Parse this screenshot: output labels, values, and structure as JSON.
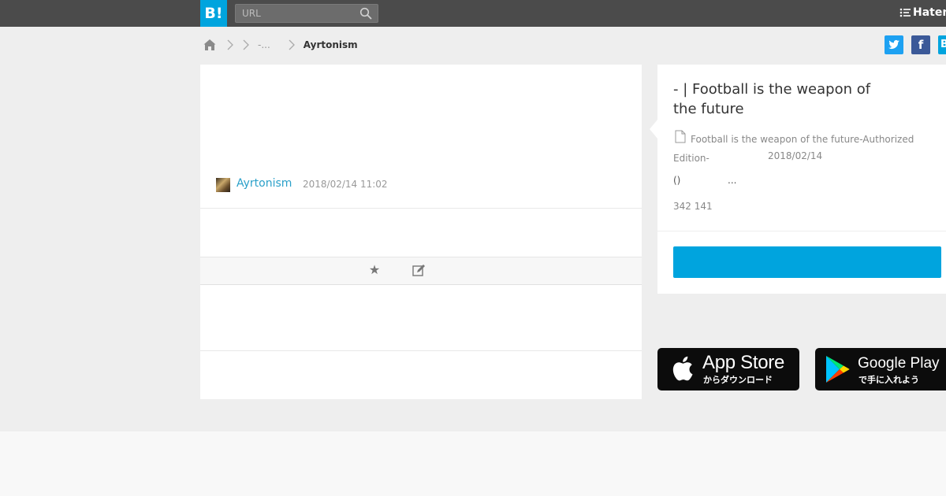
{
  "header": {
    "logo_text": "B!",
    "search_placeholder": "URL",
    "brand": "Hatena"
  },
  "breadcrumb": {
    "middle": "-...",
    "current": "Ayrtonism"
  },
  "share": {
    "twitter": "t",
    "facebook": "f",
    "hatena": "B!"
  },
  "comment": {
    "username": "Ayrtonism",
    "timestamp": "2018/02/14 11:02"
  },
  "entry": {
    "title": "- | Football is the weapon of the future",
    "source": "Football is the weapon of the future-Authorized Edition-",
    "date": "2018/02/14",
    "paren": "()",
    "ellipsis": "...",
    "counts": "342 141"
  },
  "store": {
    "apple_title": "App Store",
    "apple_sub": "からダウンロード",
    "google_title": "Google Play",
    "google_sub": "で手に入れよう"
  },
  "colors": {
    "accent": "#00a4de",
    "topbar": "#4b4b4b",
    "band": "#eeeeee",
    "link": "#2aa0c9"
  }
}
